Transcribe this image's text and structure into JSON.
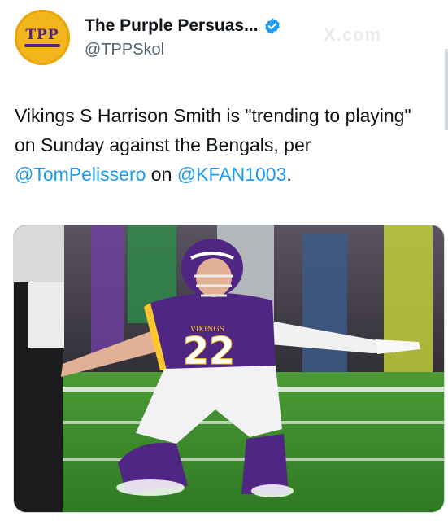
{
  "account": {
    "display_name": "The Purple Persuas...",
    "handle": "@TPPSkol",
    "avatar_text": "TPP",
    "verified": true
  },
  "watermark": "X.com",
  "tweet": {
    "text_prefix": "Vikings S Harrison Smith is \"trending to playing\" on Sunday against the Bengals, per ",
    "mention_1": "@TomPelissero",
    "text_middle": " on ",
    "mention_2": "@KFAN1003",
    "text_suffix": "."
  },
  "media": {
    "jersey_number": "22",
    "jersey_wordmark": "VIKINGS",
    "alt": "player-kneeling-photo"
  },
  "colors": {
    "link": "#1d9bf0",
    "secondary_text": "#536471",
    "vikings_purple": "#4f2683",
    "vikings_gold": "#ffc62f",
    "field_green": "#3f8a2e"
  }
}
